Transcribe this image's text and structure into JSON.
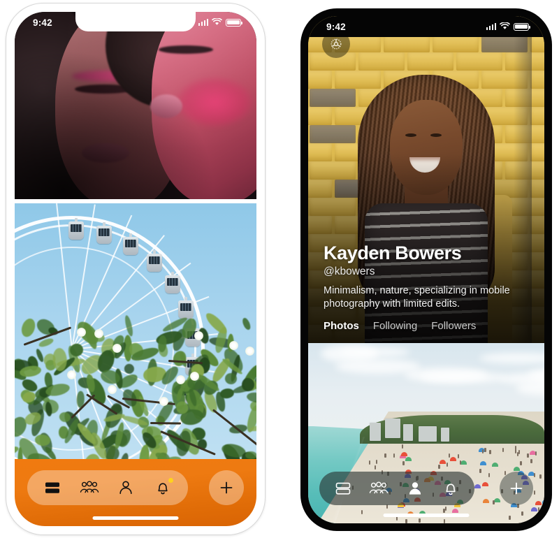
{
  "screenshot": {
    "description": "Two iPhone mockups side by side showing a photo-sharing app: a feed screen and a user profile screen"
  },
  "left_phone": {
    "frame_color": "#ffffff",
    "status_bar": {
      "time": "9:42",
      "icons": [
        "cellular-signal-icon",
        "wifi-icon",
        "battery-icon"
      ]
    },
    "feed": {
      "photos": [
        {
          "name": "beauty-portrait-photo",
          "alt": "Two women with pink and magenta makeup on dark background"
        },
        {
          "name": "ferris-wheel-photo",
          "alt": "White ferris wheel against blue sky above green foliage with white flowers"
        }
      ]
    },
    "bottom_nav": {
      "background_color": "#ee7a11",
      "items": [
        {
          "icon": "feed-list-icon",
          "label": "Feed",
          "active": true,
          "badge": false
        },
        {
          "icon": "people-group-icon",
          "label": "Friends",
          "active": false,
          "badge": false
        },
        {
          "icon": "person-icon",
          "label": "Profile",
          "active": false,
          "badge": false
        },
        {
          "icon": "bell-icon",
          "label": "Notifications",
          "active": false,
          "badge": true,
          "badge_color": "#ffd21e"
        }
      ],
      "create_button": {
        "icon": "plus-icon",
        "label": "Create"
      }
    },
    "home_indicator": true
  },
  "right_phone": {
    "frame_color": "#050505",
    "status_bar": {
      "time": "9:42",
      "icons": [
        "cellular-signal-icon",
        "wifi-icon",
        "battery-icon"
      ]
    },
    "profile": {
      "settings_button": {
        "icon": "gear-icon",
        "label": "Settings"
      },
      "cover_photo": {
        "name": "profile-cover-photo",
        "alt": "Smiling woman with long braids in striped top against yellow brick wall"
      },
      "name": "Kayden Bowers",
      "handle": "@kbowers",
      "bio": "Minimalism, nature, specializing in mobile photography with limited edits.",
      "tabs": [
        {
          "label": "Photos",
          "active": true
        },
        {
          "label": "Following",
          "active": false
        },
        {
          "label": "Followers",
          "active": false
        }
      ],
      "grid_photo": {
        "name": "beach-photo",
        "alt": "Aerial beach view with turquoise water, umbrellas and treeline"
      }
    },
    "bottom_nav": {
      "background_color": "rgba(40,50,48,0.62)",
      "items": [
        {
          "icon": "feed-list-icon",
          "label": "Feed",
          "active": false,
          "badge": false
        },
        {
          "icon": "people-group-icon",
          "label": "Friends",
          "active": false,
          "badge": false
        },
        {
          "icon": "person-icon",
          "label": "Profile",
          "active": true,
          "badge": false
        },
        {
          "icon": "bell-icon",
          "label": "Notifications",
          "active": false,
          "badge": false
        }
      ],
      "create_button": {
        "icon": "plus-icon",
        "label": "Create"
      }
    },
    "home_indicator": true
  }
}
